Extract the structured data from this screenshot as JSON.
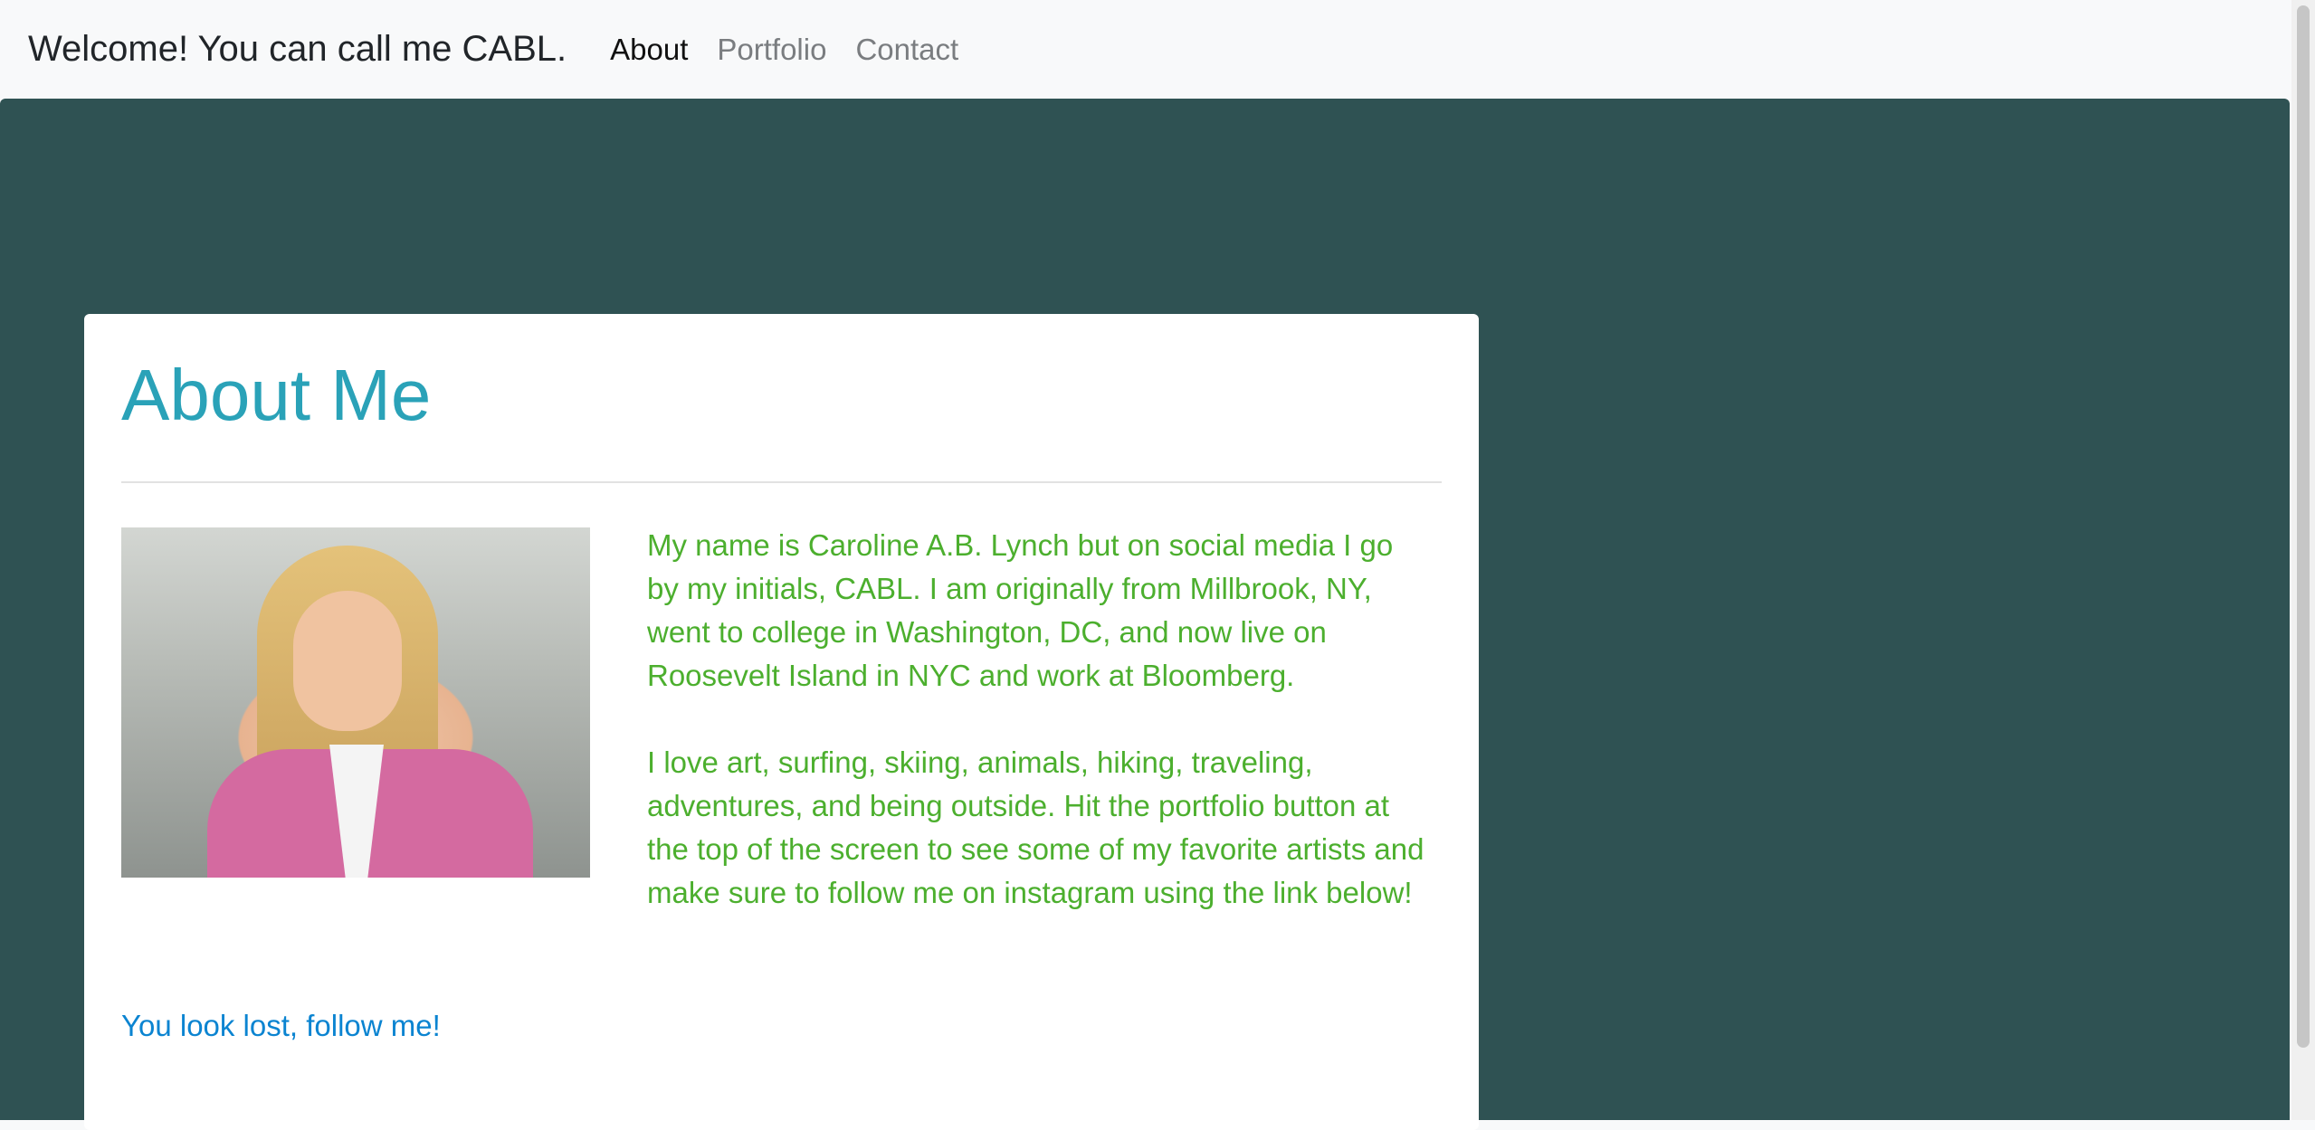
{
  "navbar": {
    "brand": "Welcome! You can call me CABL.",
    "links": [
      {
        "label": "About",
        "active": true
      },
      {
        "label": "Portfolio",
        "active": false
      },
      {
        "label": "Contact",
        "active": false
      }
    ]
  },
  "about": {
    "title": "About Me",
    "bio_paragraphs": [
      "My name is Caroline A.B. Lynch but on social media I go by my initials, CABL. I am originally from Millbrook, NY, went to college in Washington, DC, and now live on Roosevelt Island in NYC and work at Bloomberg.",
      "I love art, surfing, skiing, animals, hiking, traveling, adventures, and being outside. Hit the portfolio button at the top of the screen to see some of my favorite artists and make sure to follow me on instagram using the link below!"
    ],
    "follow_link": "You look lost, follow me!"
  },
  "colors": {
    "background": "#2f5253",
    "title": "#2aa2b8",
    "bio_text": "#4caf2e",
    "link": "#0b84d1"
  }
}
